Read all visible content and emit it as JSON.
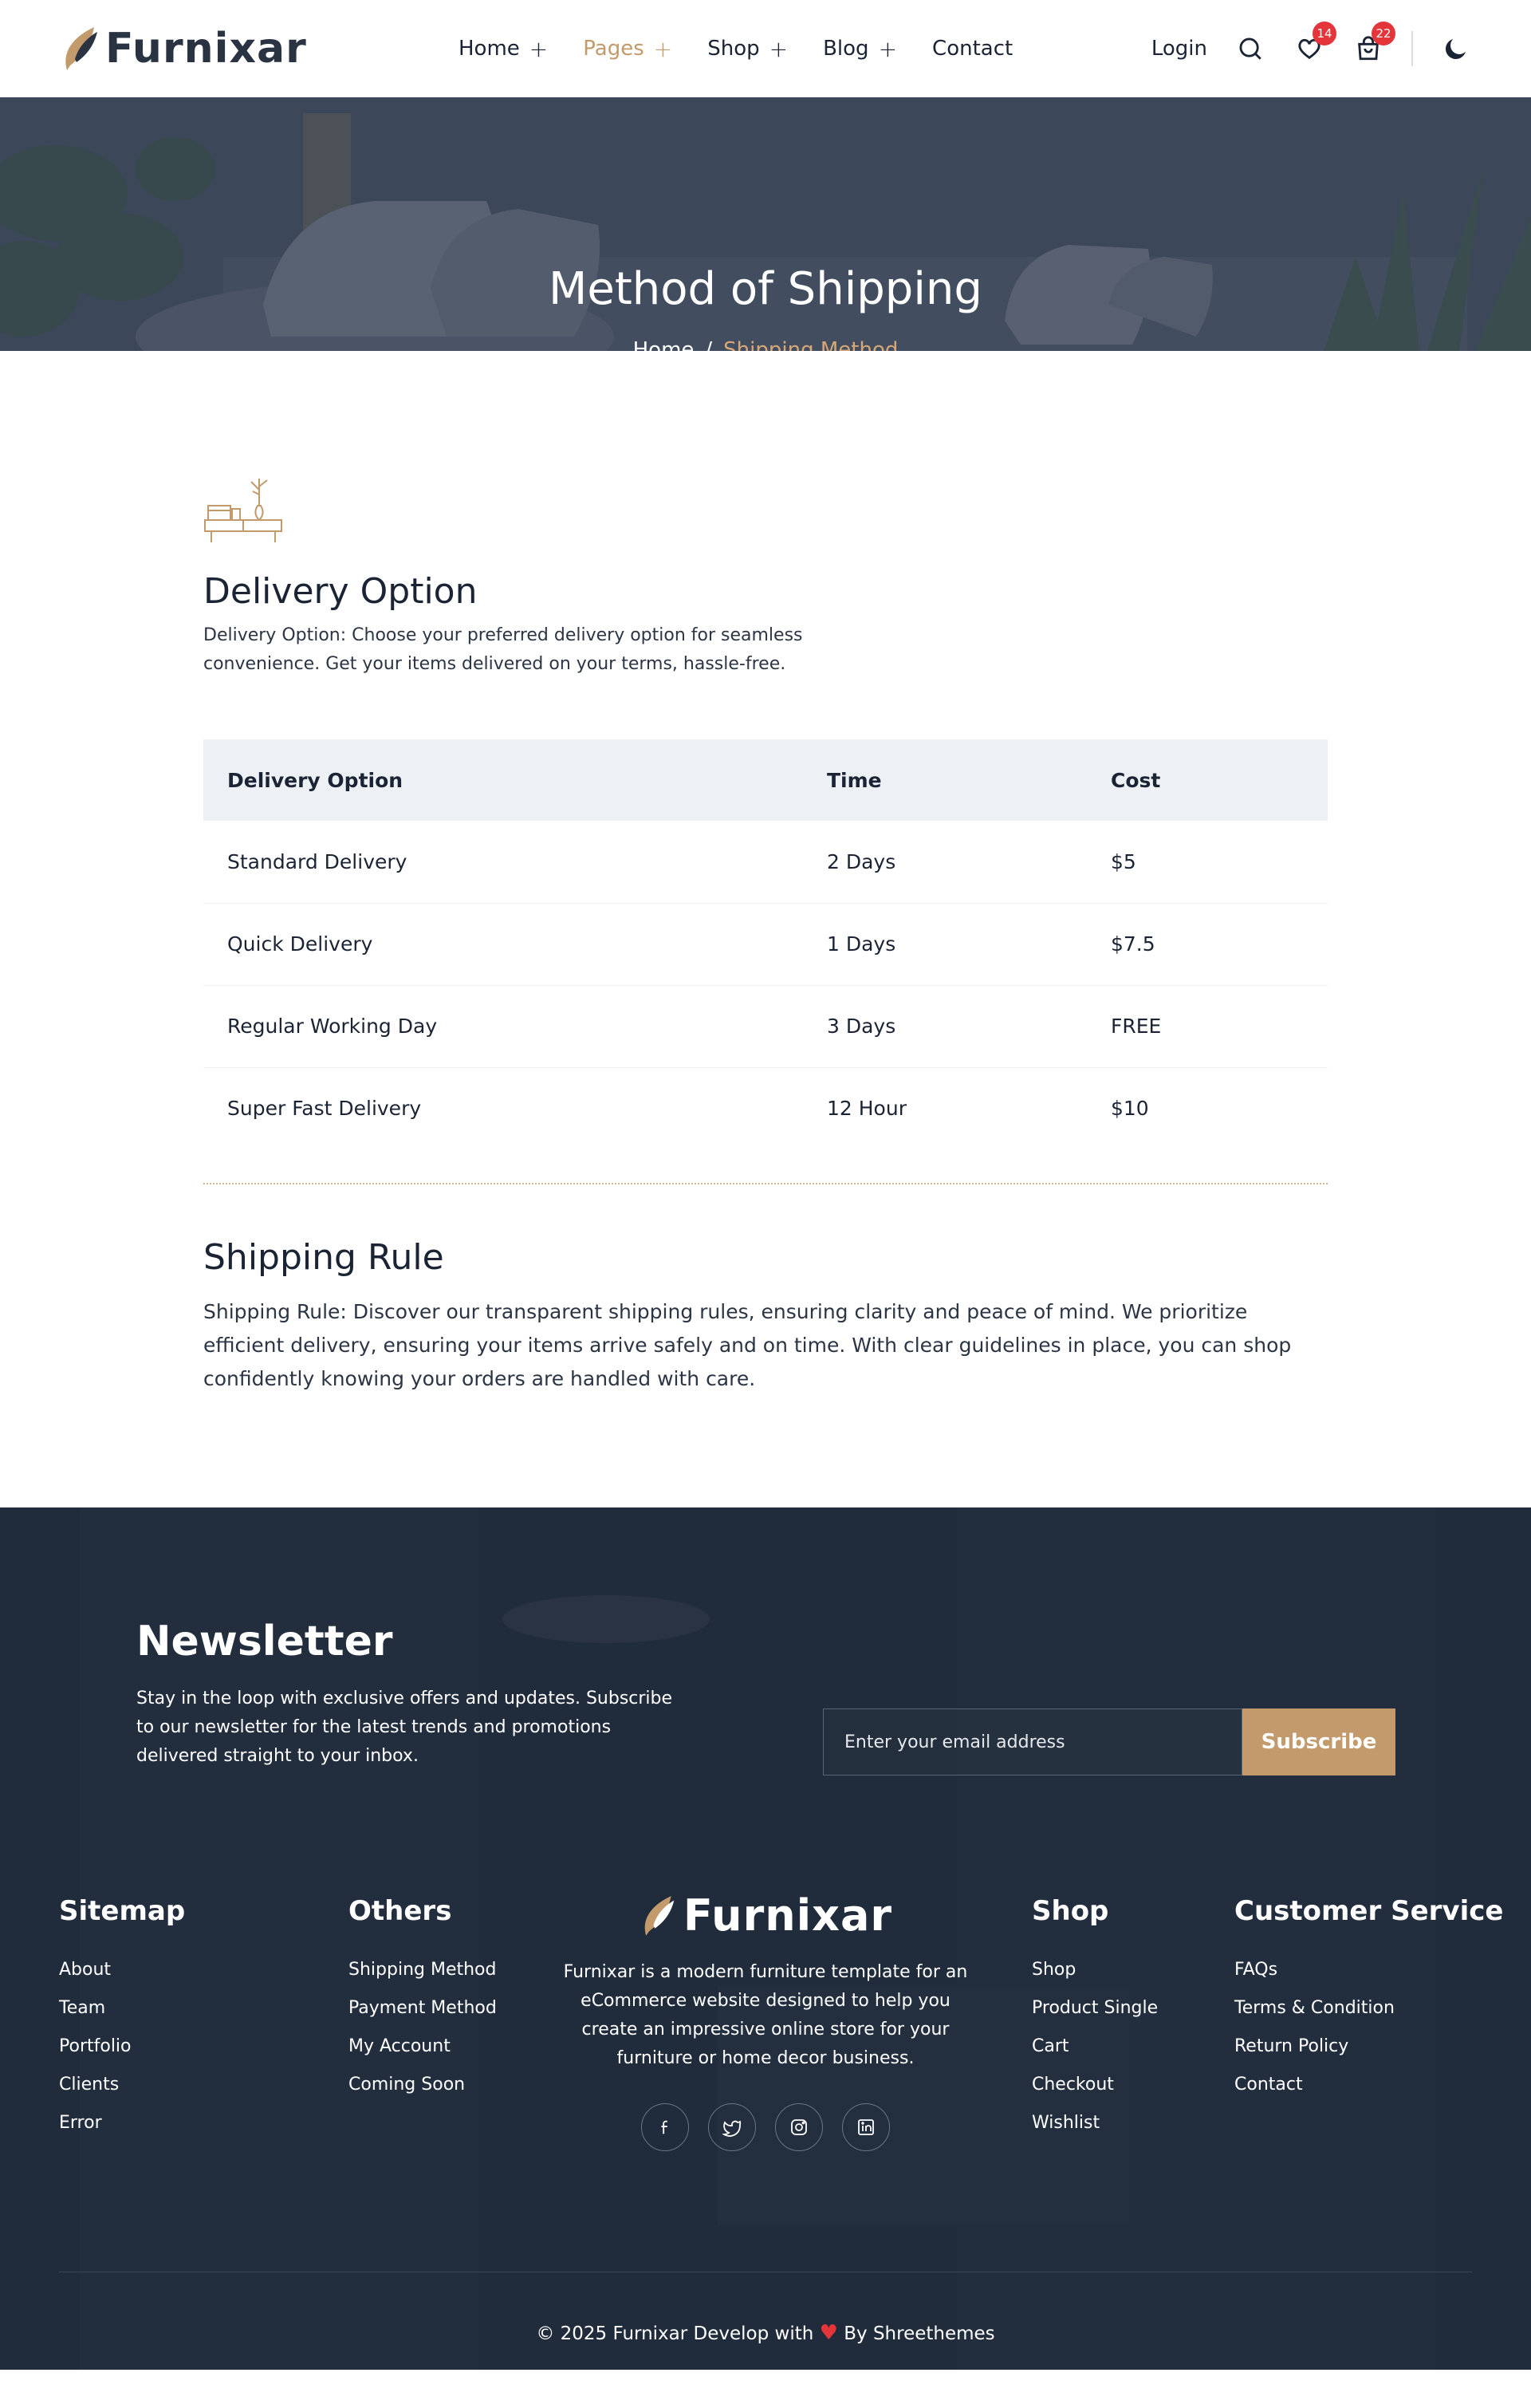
{
  "brand": {
    "name": "Furnixar",
    "accent": "#c29a6b"
  },
  "nav": {
    "items": [
      {
        "label": "Home",
        "has_sub": true
      },
      {
        "label": "Pages",
        "has_sub": true,
        "active": true
      },
      {
        "label": "Shop",
        "has_sub": true
      },
      {
        "label": "Blog",
        "has_sub": true
      },
      {
        "label": "Contact",
        "has_sub": false
      }
    ],
    "login": "Login",
    "wishlist_count": "14",
    "cart_count": "22",
    "icons": [
      "search-icon",
      "heart-icon",
      "cart-icon",
      "moon-icon"
    ]
  },
  "hero": {
    "title": "Method of Shipping",
    "breadcrumb_home": "Home",
    "breadcrumb_sep": "/",
    "breadcrumb_current": "Shipping Method"
  },
  "delivery": {
    "heading": "Delivery Option",
    "description": "Delivery Option: Choose your preferred delivery option for seamless convenience. Get your items delivered on your terms, hassle-free.",
    "table": {
      "headers": [
        "Delivery Option",
        "Time",
        "Cost"
      ],
      "rows": [
        [
          "Standard Delivery",
          "2 Days",
          "$5"
        ],
        [
          "Quick Delivery",
          "1 Days",
          "$7.5"
        ],
        [
          "Regular Working Day",
          "3 Days",
          "FREE"
        ],
        [
          "Super Fast Delivery",
          "12 Hour",
          "$10"
        ]
      ]
    }
  },
  "shipping_rule": {
    "heading": "Shipping Rule",
    "text": "Shipping Rule: Discover our transparent shipping rules, ensuring clarity and peace of mind. We prioritize efficient delivery, ensuring your items arrive safely and on time. With clear guidelines in place, you can shop confidently knowing your orders are handled with care."
  },
  "newsletter": {
    "heading": "Newsletter",
    "text": "Stay in the loop with exclusive offers and updates. Subscribe to our newsletter for the latest trends and promotions delivered straight to your inbox.",
    "placeholder": "Enter your email address",
    "button": "Subscribe"
  },
  "footer": {
    "sitemap": {
      "title": "Sitemap",
      "links": [
        "About",
        "Team",
        "Portfolio",
        "Clients",
        "Error"
      ]
    },
    "others": {
      "title": "Others",
      "links": [
        "Shipping Method",
        "Payment Method",
        "My Account",
        "Coming Soon"
      ]
    },
    "about": "Furnixar is a modern furniture template for an eCommerce website designed to help you create an impressive online store for your furniture or home decor business.",
    "socials": [
      "facebook-icon",
      "twitter-icon",
      "instagram-icon",
      "linkedin-icon"
    ],
    "shop": {
      "title": "Shop",
      "links": [
        "Shop",
        "Product Single",
        "Cart",
        "Checkout",
        "Wishlist"
      ]
    },
    "customer": {
      "title": "Customer Service",
      "links": [
        "FAQs",
        "Terms & Condition",
        "Return Policy",
        "Contact"
      ]
    },
    "copyright_pre": "© 2025 Furnixar Develop with",
    "copyright_post": "By Shreethemes"
  }
}
